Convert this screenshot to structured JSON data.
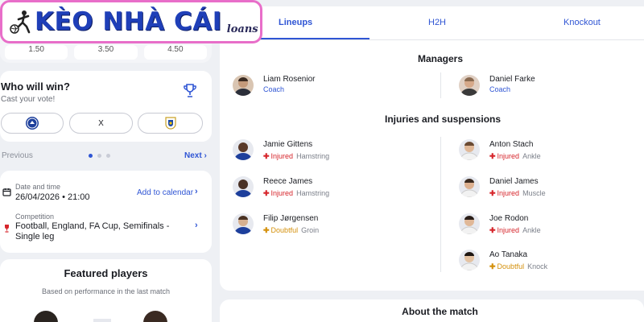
{
  "logo": {
    "main": "KÈO NHÀ CÁI",
    "sub": "loans"
  },
  "odds": [
    "1.50",
    "3.50",
    "4.50"
  ],
  "poll": {
    "title": "Who will win?",
    "subtitle": "Cast your vote!",
    "draw_label": "X",
    "prev": "Previous",
    "next": "Next"
  },
  "match_info": {
    "date_label": "Date and time",
    "date_value": "26/04/2026 • 21:00",
    "add_calendar": "Add to calendar",
    "competition_label": "Competition",
    "competition_line1": "Football, England, FA Cup, Semifinals -",
    "competition_line2": "Single leg"
  },
  "featured": {
    "title": "Featured players",
    "subtitle": "Based on performance in the last match"
  },
  "tabs": [
    "Lineups",
    "H2H",
    "Knockout"
  ],
  "managers": {
    "title": "Managers",
    "home": {
      "name": "Liam Rosenior",
      "role": "Coach"
    },
    "away": {
      "name": "Daniel Farke",
      "role": "Coach"
    }
  },
  "injuries": {
    "title": "Injuries and suspensions",
    "home": [
      {
        "name": "Jamie Gittens",
        "status": "Injured",
        "reason": "Hamstring"
      },
      {
        "name": "Reece James",
        "status": "Injured",
        "reason": "Hamstring"
      },
      {
        "name": "Filip Jørgensen",
        "status": "Doubtful",
        "reason": "Groin"
      }
    ],
    "away": [
      {
        "name": "Anton Stach",
        "status": "Injured",
        "reason": "Ankle"
      },
      {
        "name": "Daniel James",
        "status": "Injured",
        "reason": "Muscle"
      },
      {
        "name": "Joe Rodon",
        "status": "Injured",
        "reason": "Ankle"
      },
      {
        "name": "Ao Tanaka",
        "status": "Doubtful",
        "reason": "Knock"
      }
    ]
  },
  "about": {
    "title": "About the match"
  },
  "colors": {
    "accent": "#2f55d4",
    "injured": "#d6262c",
    "doubtful": "#d4900b",
    "logo_border": "#e86ec9"
  }
}
